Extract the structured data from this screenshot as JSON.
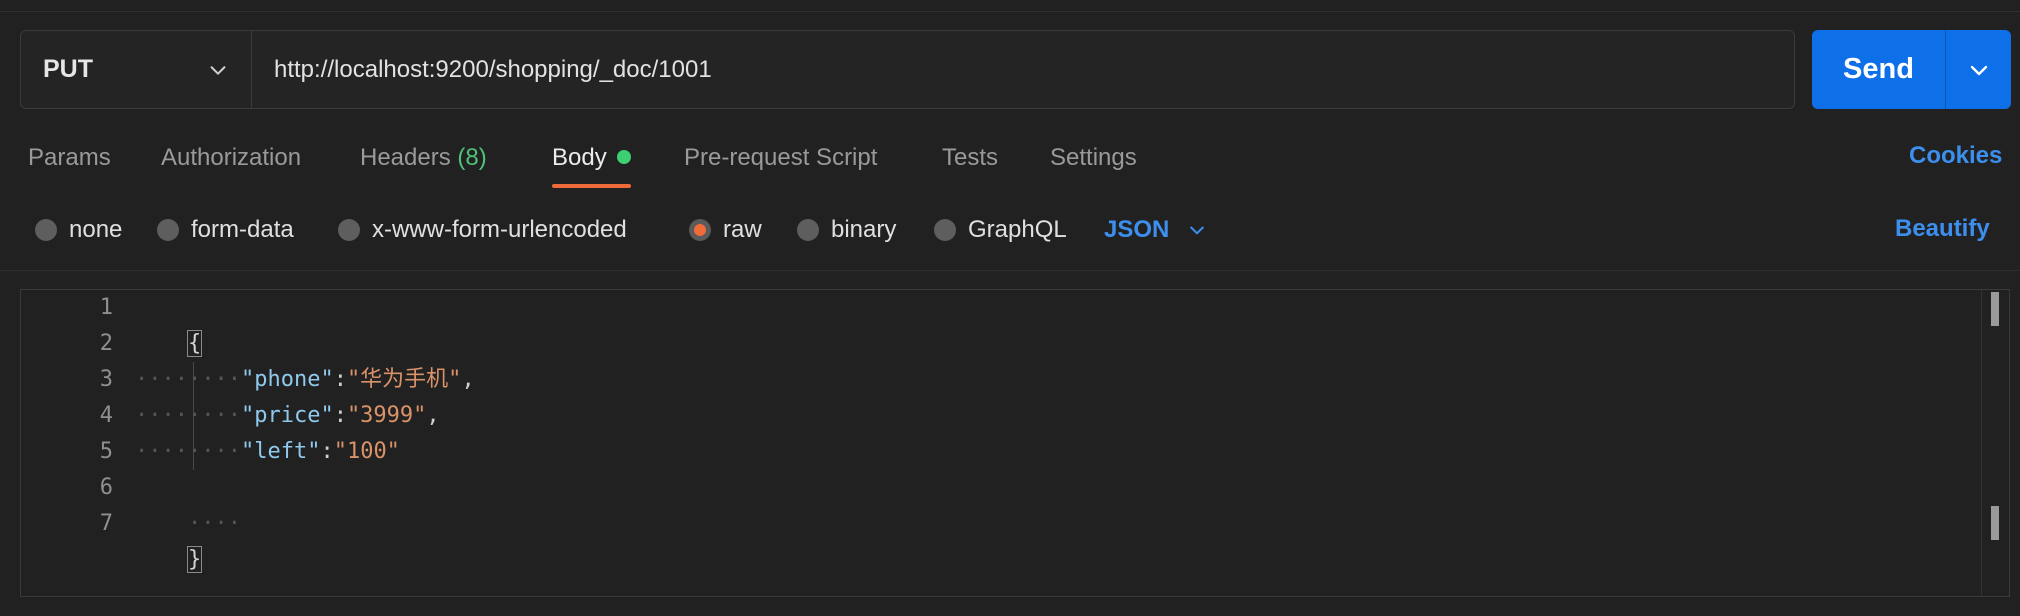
{
  "request": {
    "method": "PUT",
    "url": "http://localhost:9200/shopping/_doc/1001",
    "send_label": "Send"
  },
  "tabs": [
    {
      "label": "Params"
    },
    {
      "label": "Authorization"
    },
    {
      "label": "Headers",
      "count": "(8)"
    },
    {
      "label": "Body",
      "active": true
    },
    {
      "label": "Pre-request Script"
    },
    {
      "label": "Tests"
    },
    {
      "label": "Settings"
    }
  ],
  "cookies_label": "Cookies",
  "body_types": [
    {
      "label": "none",
      "checked": false
    },
    {
      "label": "form-data",
      "checked": false
    },
    {
      "label": "x-www-form-urlencoded",
      "checked": false
    },
    {
      "label": "raw",
      "checked": true
    },
    {
      "label": "binary",
      "checked": false
    },
    {
      "label": "GraphQL",
      "checked": false
    }
  ],
  "raw_language": "JSON",
  "beautify_label": "Beautify",
  "editor": {
    "line_numbers": [
      "1",
      "2",
      "3",
      "4",
      "5",
      "6",
      "7"
    ],
    "lines": {
      "l1": "{",
      "l2_ws": "····",
      "l3_ws": "········",
      "l3_key": "\"phone\"",
      "l3_colon": ":",
      "l3_val": "\"华为手机\"",
      "l3_comma": ",",
      "l4_ws": "········",
      "l4_key": "\"price\"",
      "l4_colon": ":",
      "l4_val": "\"3999\"",
      "l4_comma": ",",
      "l5_ws": "········",
      "l5_key": "\"left\"",
      "l5_colon": ":",
      "l5_val": "\"100\"",
      "l6_ws": "····",
      "l7": "}"
    }
  },
  "colors": {
    "accent": "#0d70e8",
    "active_tab_underline": "#ef6b3a",
    "link_blue": "#3d8fee",
    "body_dot": "#3ecf72",
    "json_key": "#8fc9ee",
    "json_string": "#d99269"
  }
}
